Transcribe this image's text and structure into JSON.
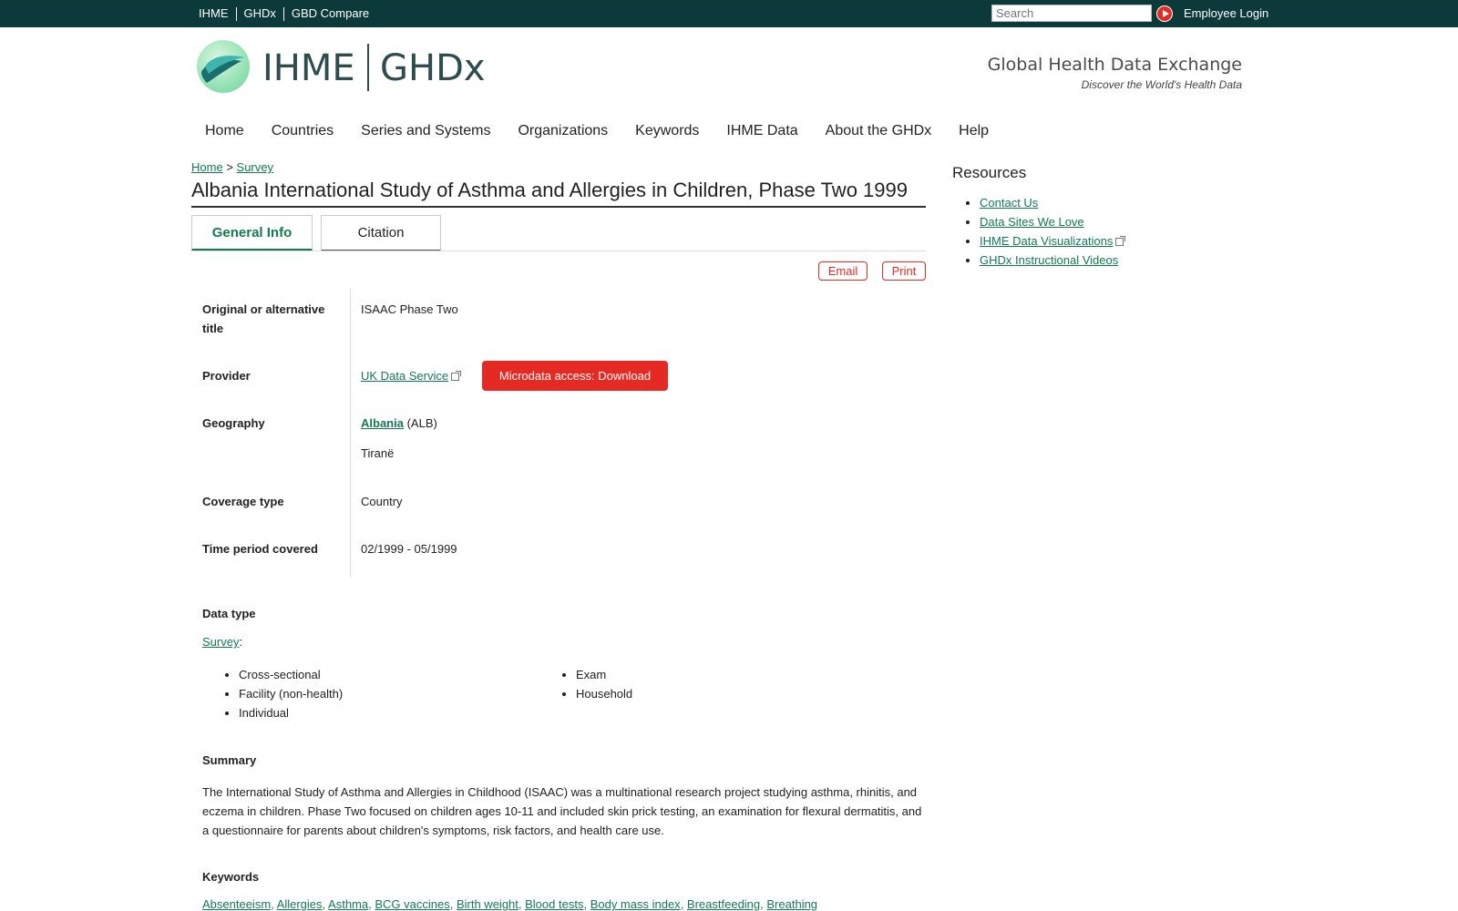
{
  "topbar": {
    "links": [
      "IHME",
      "GHDx",
      "GBD Compare"
    ],
    "search_placeholder": "Search",
    "login": "Employee Login"
  },
  "header": {
    "brand_left": "IHME",
    "brand_right": "GHDx",
    "tagline": "Global Health Data Exchange",
    "subtagline": "Discover the World's Health Data"
  },
  "nav": [
    "Home",
    "Countries",
    "Series and Systems",
    "Organizations",
    "Keywords",
    "IHME Data",
    "About the GHDx",
    "Help"
  ],
  "breadcrumb": {
    "home": "Home",
    "sep": ">",
    "current": "Survey"
  },
  "page_title": "Albania International Study of Asthma and Allergies in Children, Phase Two 1999",
  "tabs": {
    "general": "General Info",
    "citation": "Citation"
  },
  "actions": {
    "email": "Email",
    "print": "Print"
  },
  "fields": {
    "alt_title_label": "Original or alternative title",
    "alt_title_value": "ISAAC Phase Two",
    "provider_label": "Provider",
    "provider_value": "UK Data Service",
    "download_label": "Microdata access: Download",
    "geography_label": "Geography",
    "geography_country": "Albania",
    "geography_code": "(ALB)",
    "geography_city": "Tiranë",
    "coverage_label": "Coverage type",
    "coverage_value": "Country",
    "time_label": "Time period covered",
    "time_value": "02/1999 - 05/1999"
  },
  "data_type": {
    "label": "Data type",
    "link": "Survey",
    "col1": [
      "Cross-sectional",
      "Facility (non-health)",
      "Individual"
    ],
    "col2": [
      "Exam",
      "Household"
    ]
  },
  "summary": {
    "label": "Summary",
    "text": "The International Study of Asthma and Allergies in Childhood (ISAAC) was a multinational research project studying asthma, rhinitis, and eczema in children. Phase Two focused on children ages 10-11 and included skin prick testing, an examination for flexural dermatitis, and a questionnaire for parents about children's symptoms, risk factors, and health care use."
  },
  "keywords": {
    "label": "Keywords",
    "items": [
      "Absenteeism",
      "Allergies",
      "Asthma",
      "BCG vaccines",
      "Birth weight",
      "Blood tests",
      "Body mass index",
      "Breastfeeding",
      "Breathing"
    ]
  },
  "resources": {
    "title": "Resources",
    "items": [
      "Contact Us",
      "Data Sites We Love",
      "IHME Data Visualizations",
      "GHDx Instructional Videos"
    ]
  },
  "colors": {
    "topbar": "#0c3a3a",
    "link": "#137a52",
    "accent": "#e52a24"
  }
}
